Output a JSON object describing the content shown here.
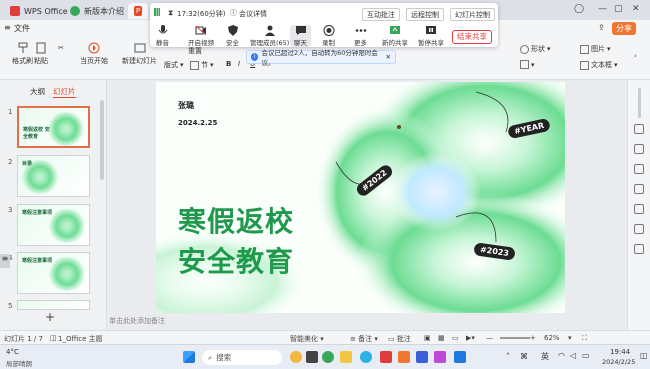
{
  "tabs": [
    {
      "label": "WPS Office",
      "color": "#e03c3c"
    },
    {
      "label": "新版本介绍",
      "color": "#3aa65b"
    },
    {
      "label": "P",
      "color": "#e04a27"
    }
  ],
  "menu": {
    "file": "文件",
    "share": "分享"
  },
  "ribbon": {
    "format_painter": "格式刷",
    "paste": "粘贴",
    "from_current": "当页开始",
    "new_slide": "新建幻灯片",
    "layout": "版式",
    "section": "节",
    "reset": "重置",
    "shape": "形状",
    "picture": "图片",
    "textbox": "文本框"
  },
  "meeting": {
    "time": "17:32(60分钟)",
    "details": "会议详情",
    "interactive_annotation": "互动批注",
    "remote_control": "远程控制",
    "slide_control": "幻灯片控制",
    "tools": [
      {
        "label": "静音",
        "icon": "mic-icon"
      },
      {
        "label": "开启视频",
        "icon": "camera-icon"
      },
      {
        "label": "安全",
        "icon": "shield-icon"
      },
      {
        "label": "管理成员(65)",
        "icon": "members-icon"
      },
      {
        "label": "聊天",
        "icon": "chat-icon"
      },
      {
        "label": "录制",
        "icon": "record-icon"
      },
      {
        "label": "更多",
        "icon": "more-icon"
      },
      {
        "label": "新的共享",
        "icon": "share-icon"
      },
      {
        "label": "暂停共享",
        "icon": "pause-icon"
      }
    ],
    "end_share": "结束共享"
  },
  "notice": "会议已超过2人，自动转为60分钟限时会议。",
  "leftpane": {
    "outline": "大纲",
    "slides": "幻灯片",
    "thumbs": [
      {
        "num": "1",
        "title": "寒假返校 安全教育"
      },
      {
        "num": "2",
        "title": "目录"
      },
      {
        "num": "3",
        "title": "寒假注意事项"
      },
      {
        "num": "4",
        "title": "寒假注意事项"
      },
      {
        "num": "5",
        "title": ""
      }
    ],
    "add": "+"
  },
  "slide": {
    "author": "张璐",
    "date": "2024.2.25",
    "title_line1": "寒假返校",
    "title_line2": "安全教育",
    "tags": [
      "#YEAR",
      "#2022",
      "#2023"
    ]
  },
  "notes_placeholder": "单击此处添加备注",
  "status": {
    "slide_pos": "幻灯片 1 / 7",
    "theme": "1_Office 主题",
    "smart_beautify": "智能美化",
    "notes": "备注",
    "comment": "批注",
    "zoom": "62%"
  },
  "taskbar": {
    "weather_temp": "4°C",
    "weather_desc": "局部晴朗",
    "search": "搜索",
    "ime": "英",
    "time": "19:44",
    "date": "2024/2/25"
  }
}
